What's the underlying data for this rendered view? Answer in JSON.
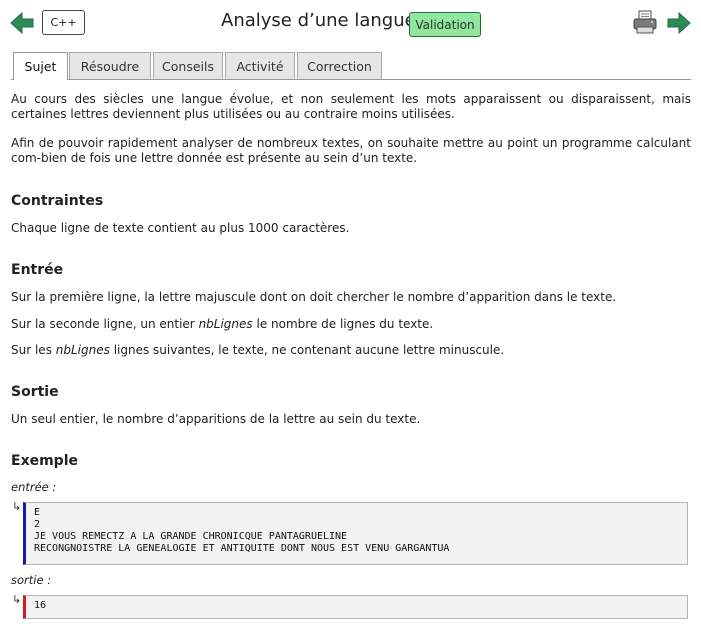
{
  "header": {
    "language_button": "C++",
    "title": "Analyse d’une langue",
    "validation_badge": "Validation",
    "colors": {
      "arrow": "#2e8b57",
      "validation_bg": "#93e6a0"
    }
  },
  "tabs": [
    "Sujet",
    "Résoudre",
    "Conseils",
    "Activité",
    "Correction"
  ],
  "active_tab": "Sujet",
  "intro": {
    "p1": "Au cours des siècles une langue évolue, et non seulement les mots apparaissent ou disparaissent, mais certaines lettres deviennent plus utilisées ou au contraire moins utilisées.",
    "p2": "Afin de pouvoir rapidement analyser de nombreux textes, on souhaite mettre au point un programme calculant com-bien de fois une lettre donnée est présente au sein d’un texte."
  },
  "contraintes": {
    "heading": "Contraintes",
    "text": "Chaque ligne de texte contient au plus 1000 caractères."
  },
  "entree": {
    "heading": "Entrée",
    "line1": "Sur la première ligne, la lettre majuscule dont on doit chercher le nombre d’apparition dans le texte.",
    "line2_before": "Sur la seconde ligne, un entier ",
    "line2_var": "nbLignes",
    "line2_after": " le nombre de lignes du texte.",
    "line3_before": "Sur les ",
    "line3_var": "nbLignes",
    "line3_after": " lignes suivantes, le texte, ne contenant aucune lettre minuscule."
  },
  "sortie": {
    "heading": "Sortie",
    "text": "Un seul entier, le nombre d’apparitions de la lettre au sein du texte."
  },
  "exemple": {
    "heading": "Exemple",
    "input_label": "entrée :",
    "input": "E\n2\nJE VOUS REMECTZ A LA GRANDE CHRONICQUE PANTAGRUELINE\nRECONGNOISTRE LA GENEALOGIE ET ANTIQUITE DONT NOUS EST VENU GARGANTUA",
    "output_label": "sortie :",
    "output": "16",
    "hook_glyph": "↳"
  }
}
